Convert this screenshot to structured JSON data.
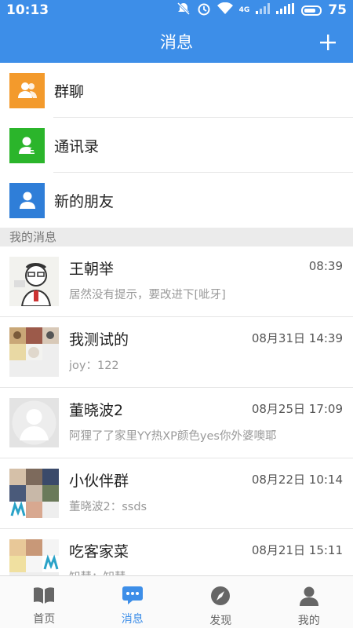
{
  "status_bar": {
    "time": "10:13",
    "battery": "75",
    "network": "4G"
  },
  "app_bar": {
    "title": "消息",
    "add_icon": "plus-icon"
  },
  "shortcuts": [
    {
      "label": "群聊",
      "icon": "group-chat-icon",
      "color": "#f39a2c"
    },
    {
      "label": "通讯录",
      "icon": "contacts-icon",
      "color": "#2bb52b"
    },
    {
      "label": "新的朋友",
      "icon": "new-friend-icon",
      "color": "#2f7ed8"
    }
  ],
  "section_title": "我的消息",
  "conversations": [
    {
      "name": "王朝举",
      "time": "08:39",
      "preview": "居然没有提示，要改进下[呲牙]"
    },
    {
      "name": "我测试的",
      "time": "08月31日 14:39",
      "preview": "joy：122"
    },
    {
      "name": "董晓波2",
      "time": "08月25日 17:09",
      "preview": "阿狸了了家里YY热XP颜色yes你外婆噢耶"
    },
    {
      "name": "小伙伴群",
      "time": "08月22日 10:14",
      "preview": "董晓波2：ssds"
    },
    {
      "name": "吃客家菜",
      "time": "08月21日 15:11",
      "preview": "知慧：知慧"
    }
  ],
  "tabs": [
    {
      "label": "首页",
      "icon": "book-icon",
      "active": false
    },
    {
      "label": "消息",
      "icon": "chat-bubble-icon",
      "active": true
    },
    {
      "label": "发现",
      "icon": "compass-icon",
      "active": false
    },
    {
      "label": "我的",
      "icon": "person-icon",
      "active": false
    }
  ],
  "colors": {
    "primary": "#3d8ee8",
    "tab_inactive": "#666666"
  }
}
